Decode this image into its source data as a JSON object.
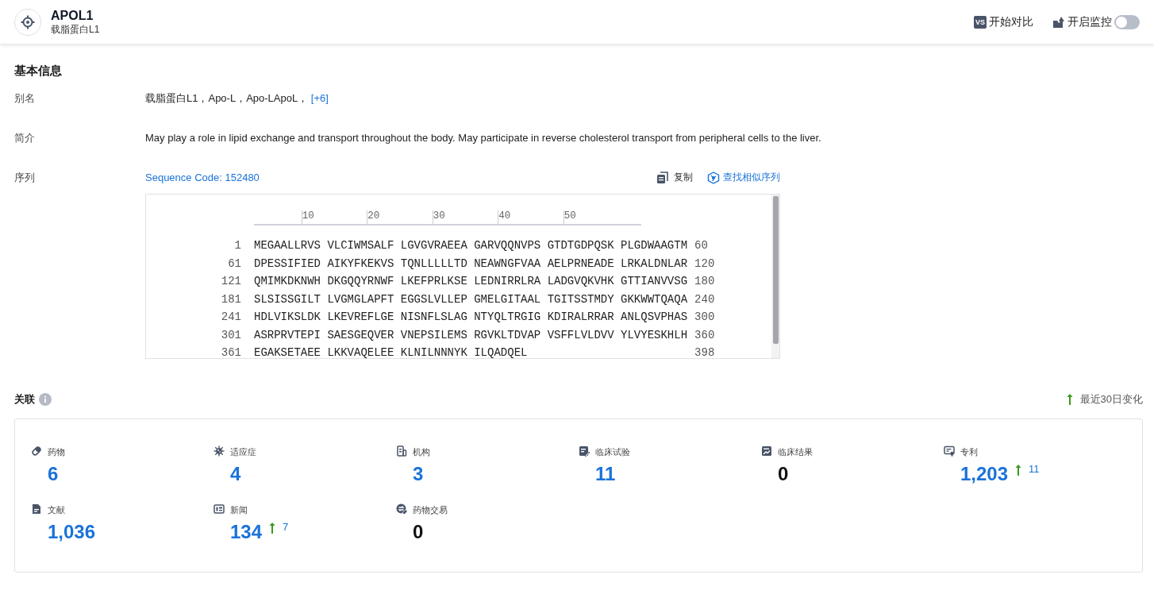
{
  "header": {
    "title": "APOL1",
    "subtitle": "载脂蛋白L1",
    "compare": {
      "badge": "VS",
      "label": "开始对比"
    },
    "monitor": {
      "label": "开启监控",
      "on": false
    }
  },
  "basic_info": {
    "title": "基本信息",
    "rows": [
      {
        "kind": "aliases",
        "label": "别名",
        "text": "载脂蛋白L1，Apo-L，Apo-LApoL，",
        "more": "[+6]"
      },
      {
        "kind": "text",
        "label": "简介",
        "text": "May play a role in lipid exchange and transport throughout the body. May participate in reverse cholesterol transport from peripheral cells to the liver."
      },
      {
        "kind": "sequence",
        "label": "序列",
        "code_link": "Sequence Code: 152480",
        "actions": [
          {
            "kind": "copy",
            "label": "复制"
          },
          {
            "kind": "similar",
            "label": "查找相似序列"
          }
        ],
        "ruler": [
          "10",
          "20",
          "30",
          "40",
          "50"
        ],
        "lines": [
          {
            "start": "1",
            "groups": [
              "MEGAALLRVS",
              "VLCIWMSALF",
              "LGVGVRAEEA",
              "GARVQQNVPS",
              "GTDTGDPQSK",
              "PLGDWAAGTM"
            ],
            "end": "60"
          },
          {
            "start": "61",
            "groups": [
              "DPESSIFIED",
              "AIKYFKEKVS",
              "TQNLLLLLTD",
              "NEAWNGFVAA",
              "AELPRNEADE",
              "LRKALDNLAR"
            ],
            "end": "120"
          },
          {
            "start": "121",
            "groups": [
              "QMIMKDKNWH",
              "DKGQQYRNWF",
              "LKEFPRLKSE",
              "LEDNIRRLRA",
              "LADGVQKVHK",
              "GTTIANVVSG"
            ],
            "end": "180"
          },
          {
            "start": "181",
            "groups": [
              "SLSISSGILT",
              "LVGMGLAPFT",
              "EGGSLVLLEP",
              "GMELGITAAL",
              "TGITSSTMDY",
              "GKKWWTQAQA"
            ],
            "end": "240"
          },
          {
            "start": "241",
            "groups": [
              "HDLVIKSLDK",
              "LKEVREFLGE",
              "NISNFLSLAG",
              "NTYQLTRGIG",
              "KDIRALRRAR",
              "ANLQSVPHAS"
            ],
            "end": "300"
          },
          {
            "start": "301",
            "groups": [
              "ASRPRVTEPI",
              "SAESGEQVER",
              "VNEPSILEMS",
              "RGVKLTDVAP",
              "VSFFLVLDVV",
              "YLVYESKHLH"
            ],
            "end": "360"
          },
          {
            "start": "361",
            "groups": [
              "EGAKSETAEE",
              "LKKVAQELEE",
              "KLNILNNNYK",
              "ILQADQEL"
            ],
            "end": "398"
          }
        ]
      }
    ]
  },
  "relations": {
    "title": "关联",
    "legend": "最近30日变化",
    "items": [
      {
        "kind": "drug",
        "label": "药物",
        "value": "6",
        "linked": true
      },
      {
        "kind": "indication",
        "label": "适应症",
        "value": "4",
        "linked": true
      },
      {
        "kind": "organization",
        "label": "机构",
        "value": "3",
        "linked": true
      },
      {
        "kind": "trial",
        "label": "临床试验",
        "value": "11",
        "linked": true
      },
      {
        "kind": "result",
        "label": "临床结果",
        "value": "0",
        "linked": false
      },
      {
        "kind": "patent",
        "label": "专利",
        "value": "1,203",
        "linked": true,
        "change": "11"
      },
      {
        "kind": "literature",
        "label": "文献",
        "value": "1,036",
        "linked": true
      },
      {
        "kind": "news",
        "label": "新闻",
        "value": "134",
        "linked": true,
        "change": "7"
      },
      {
        "kind": "deal",
        "label": "药物交易",
        "value": "0",
        "linked": false
      }
    ]
  }
}
